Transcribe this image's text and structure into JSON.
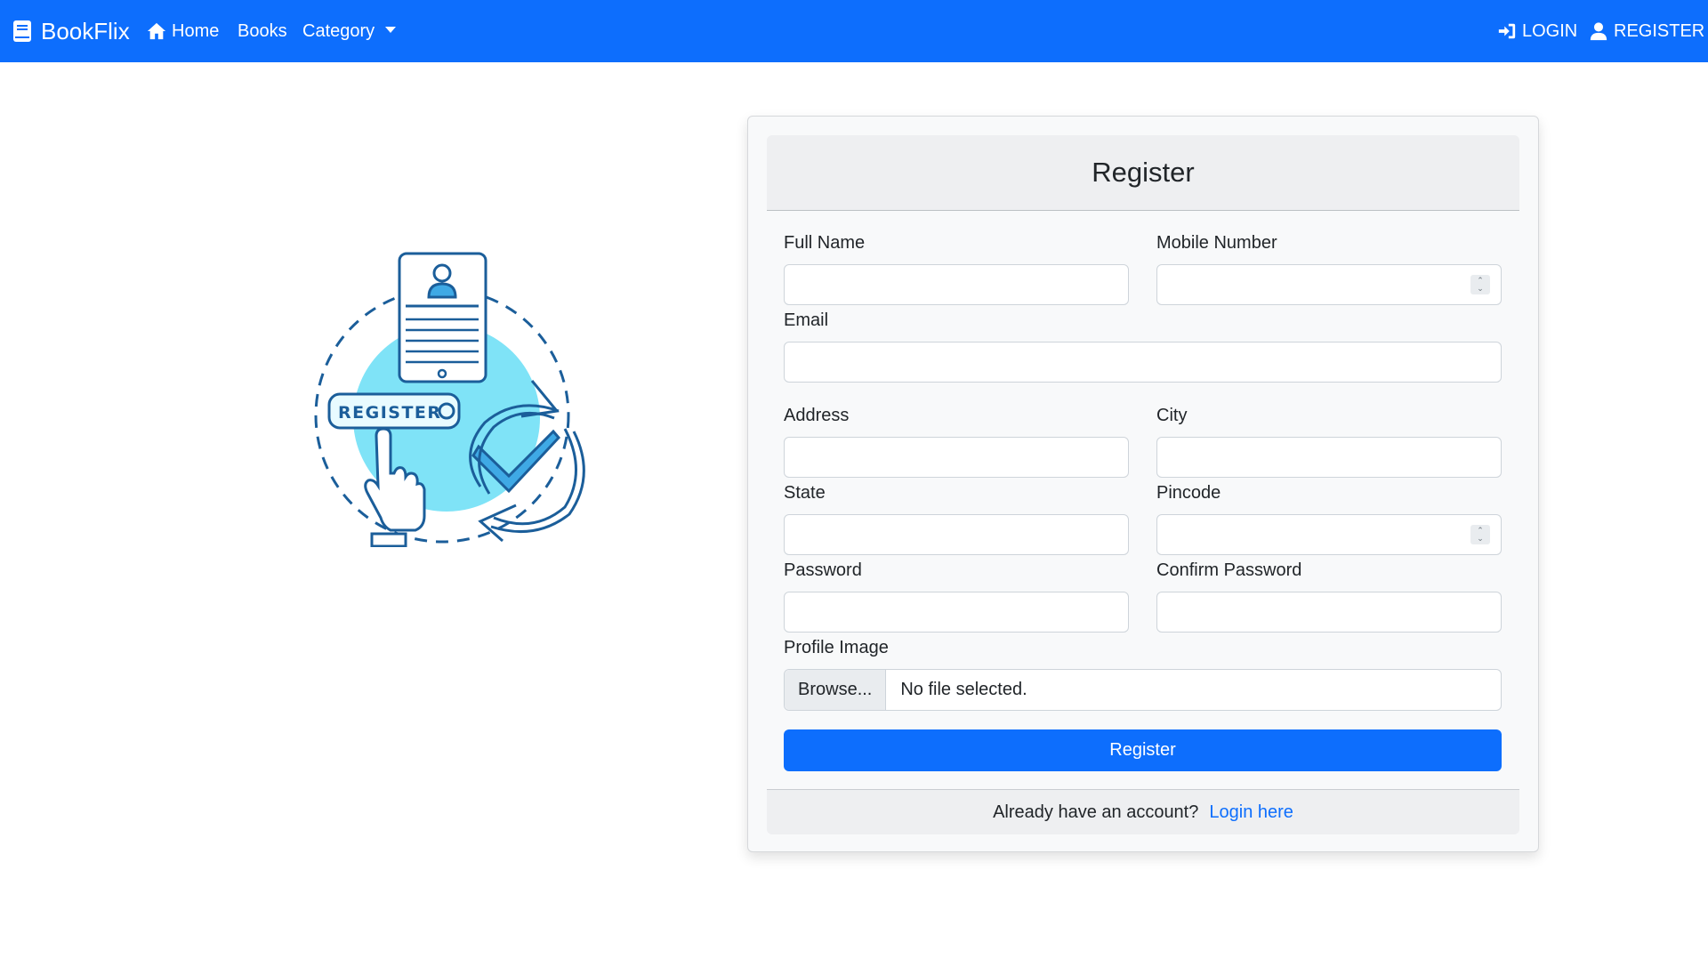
{
  "navbar": {
    "brand": "BookFlix",
    "home": "Home",
    "books": "Books",
    "category": "Category",
    "login": "LOGIN",
    "register": "REGISTER",
    "color": "#0d6efd"
  },
  "illustration": {
    "badge_text": "REGISTER"
  },
  "form": {
    "title": "Register",
    "full_name_label": "Full Name",
    "mobile_label": "Mobile Number",
    "email_label": "Email",
    "address_label": "Address",
    "city_label": "City",
    "state_label": "State",
    "pincode_label": "Pincode",
    "password_label": "Password",
    "confirm_password_label": "Confirm Password",
    "profile_image_label": "Profile Image",
    "browse_label": "Browse...",
    "no_file_text": "No file selected.",
    "submit_label": "Register"
  },
  "footer": {
    "prompt": "Already have an account?",
    "link": "Login here"
  }
}
